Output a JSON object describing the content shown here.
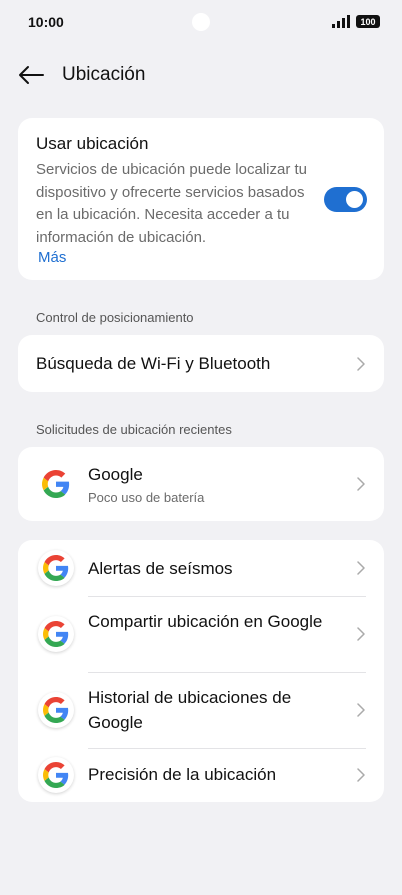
{
  "status_bar": {
    "time": "10:00",
    "battery": "100"
  },
  "header": {
    "title": "Ubicación"
  },
  "use_location": {
    "title": "Usar ubicación",
    "description": "Servicios de ubicación puede localizar tu dispositivo y ofrecerte servicios basados en la ubicación. Necesita acceder a tu información de ubicación.",
    "more_label": "Más",
    "enabled": true,
    "accent_color": "#1f6fd1"
  },
  "sections": {
    "positioning": "Control de posicionamiento",
    "recent": "Solicitudes de ubicación recientes"
  },
  "wifi_bluetooth": {
    "label": "Búsqueda de Wi-Fi y Bluetooth"
  },
  "recent_google": {
    "title": "Google",
    "subtitle": "Poco uso de batería"
  },
  "apps": [
    {
      "label": "Alertas de seísmos"
    },
    {
      "label": "Compartir ubicación en Google"
    },
    {
      "label": "Historial de ubicaciones de Google"
    },
    {
      "label": "Precisión de la ubicación"
    }
  ]
}
